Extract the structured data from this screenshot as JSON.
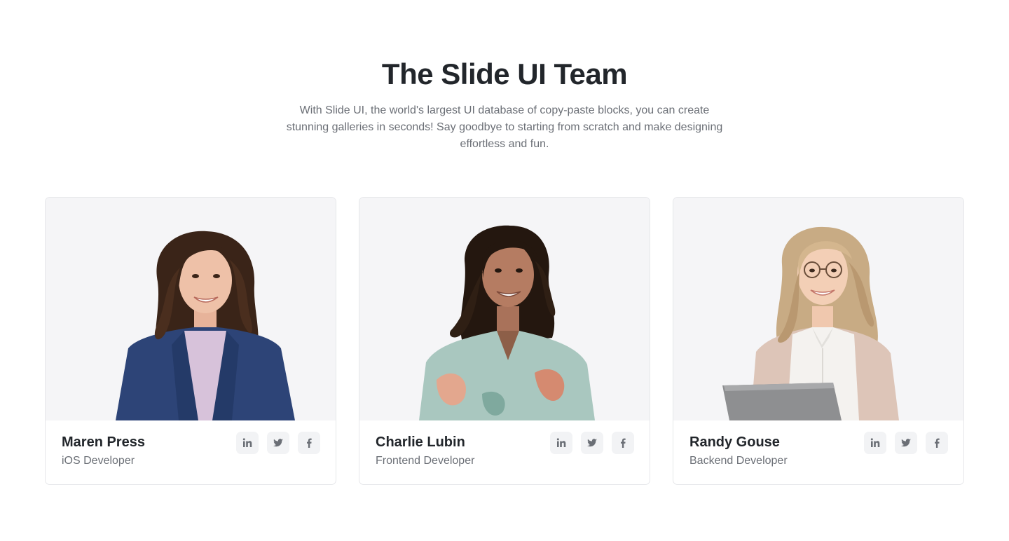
{
  "header": {
    "title": "The Slide UI Team",
    "subtitle": "With Slide UI, the world's largest UI database of copy-paste blocks, you can create stunning galleries in seconds! Say goodbye to starting from scratch and make designing effortless and fun."
  },
  "members": [
    {
      "name": "Maren Press",
      "role": "iOS Developer"
    },
    {
      "name": "Charlie Lubin",
      "role": "Frontend Developer"
    },
    {
      "name": "Randy Gouse",
      "role": "Backend Developer"
    }
  ],
  "social_icons": [
    "linkedin-icon",
    "twitter-icon",
    "facebook-icon"
  ],
  "colors": {
    "title": "#22262b",
    "muted_text": "#6b6f76",
    "card_border": "#e6e7ea",
    "photo_bg": "#f5f5f7",
    "icon_bg": "#f2f3f5"
  }
}
